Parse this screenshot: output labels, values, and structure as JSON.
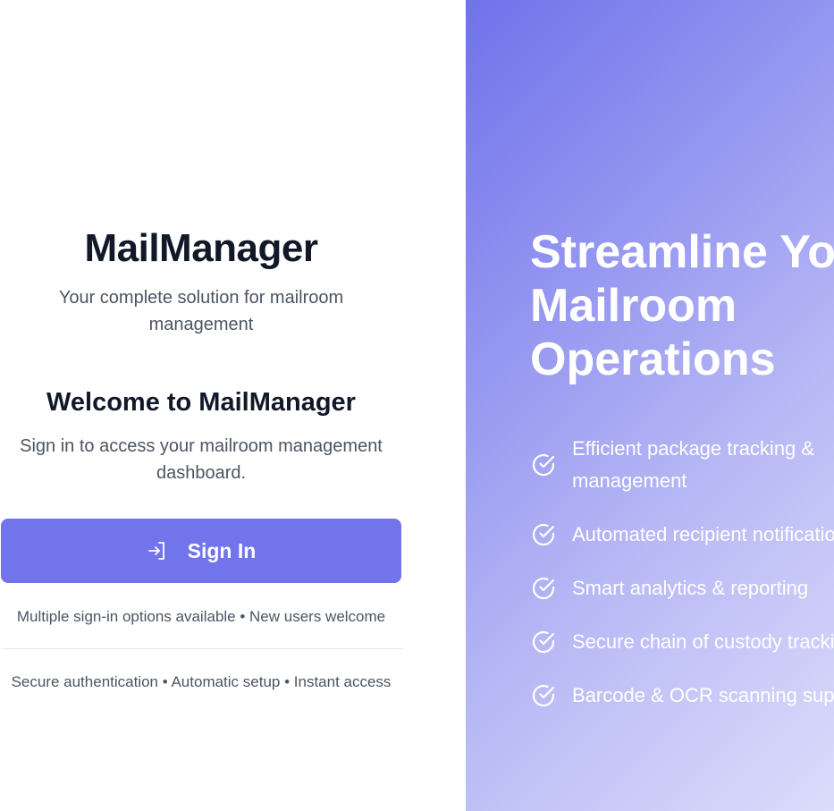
{
  "brand": {
    "title": "MailManager",
    "subtitle": "Your complete solution for mailroom management"
  },
  "welcome": {
    "title": "Welcome to MailManager",
    "text": "Sign in to access your mailroom management dashboard."
  },
  "signin": {
    "label": "Sign In",
    "icon": "sign-in-icon"
  },
  "options_text": "Multiple sign-in options available • New users welcome",
  "footer_text": "Secure authentication • Automatic setup • Instant access",
  "hero": {
    "title_lines": [
      "Streamline Your",
      "Mailroom",
      "Operations"
    ],
    "features": [
      "Efficient package tracking & management",
      "Automated recipient notifications",
      "Smart analytics & reporting",
      "Secure chain of custody tracking",
      "Barcode & OCR scanning support"
    ],
    "feature_icon": "check-circle-icon"
  },
  "colors": {
    "accent": "#7274ec",
    "heading": "#111827",
    "muted": "#4b5563"
  }
}
